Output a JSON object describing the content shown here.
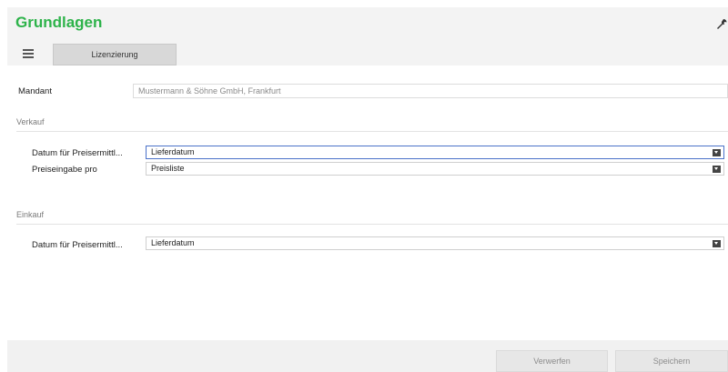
{
  "header": {
    "title": "Grundlagen",
    "title_color": "#2db34a",
    "tool_icon": "wrench-icon",
    "menu_icon": "hamburger-menu-icon",
    "tabs": [
      {
        "label": "Lizenzierung"
      }
    ]
  },
  "form": {
    "mandant": {
      "label": "Mandant",
      "value": "Mustermann & Söhne GmbH, Frankfurt"
    },
    "verkauf": {
      "section_label": "Verkauf",
      "datum": {
        "label": "Datum für Preisermittl...",
        "value": "Lieferdatum",
        "focused": true
      },
      "preiseingabe": {
        "label": "Preiseingabe pro",
        "value": "Preisliste"
      }
    },
    "einkauf": {
      "section_label": "Einkauf",
      "datum": {
        "label": "Datum für Preisermittl...",
        "value": "Lieferdatum"
      }
    }
  },
  "footer": {
    "discard_label": "Verwerfen",
    "save_label": "Speichern"
  }
}
